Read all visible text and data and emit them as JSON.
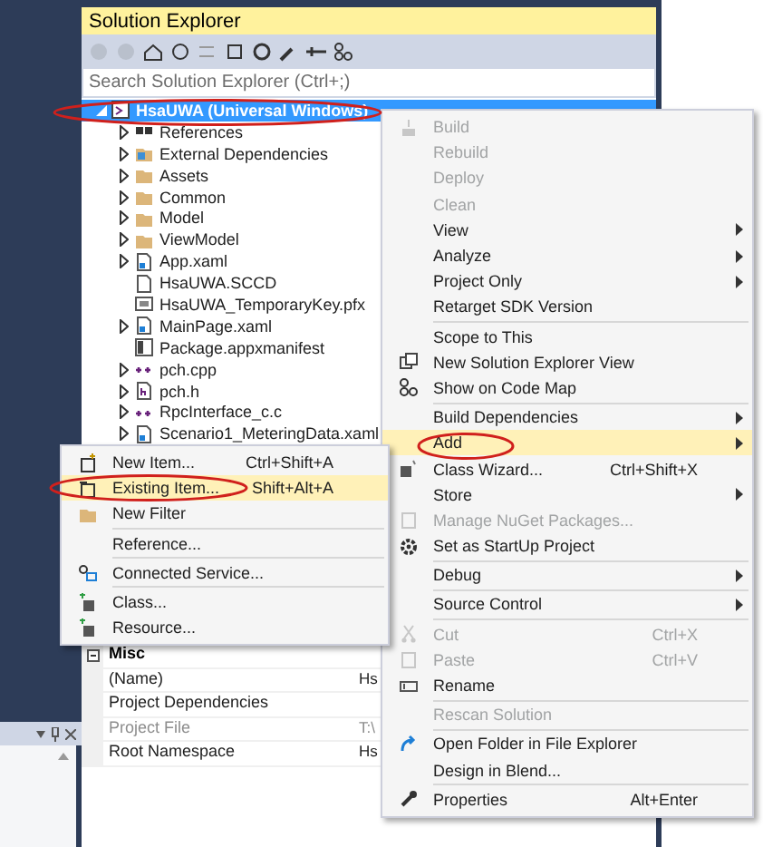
{
  "solution_explorer": {
    "title": "Solution Explorer",
    "search": {
      "placeholder": "Search Solution Explorer (Ctrl+;)"
    },
    "tree": [
      {
        "label": "HsaUWA (Universal Windows)",
        "selected": true,
        "expanded": true,
        "children": [
          {
            "label": "References",
            "selected": false,
            "expanded": false
          },
          {
            "label": "External Dependencies",
            "selected": false,
            "expanded": false
          },
          {
            "label": "Assets",
            "selected": false,
            "expanded": false
          },
          {
            "label": "Common",
            "selected": false,
            "expanded": false
          },
          {
            "label": "Model",
            "selected": false,
            "expanded": false
          },
          {
            "label": "ViewModel",
            "selected": false,
            "expanded": false
          },
          {
            "label": "App.xaml",
            "selected": false,
            "expanded": false
          },
          {
            "label": "HsaUWA.SCCD",
            "selected": false
          },
          {
            "label": "HsaUWA_TemporaryKey.pfx",
            "selected": false
          },
          {
            "label": "MainPage.xaml",
            "selected": false,
            "expanded": false
          },
          {
            "label": "Package.appxmanifest",
            "selected": false
          },
          {
            "label": "pch.cpp",
            "selected": false,
            "expanded": false
          },
          {
            "label": "pch.h",
            "selected": false,
            "expanded": false
          },
          {
            "label": "RpcInterface_c.c",
            "selected": false,
            "expanded": false
          },
          {
            "label": "Scenario1_MeteringData.xaml",
            "selected": false,
            "expanded": false
          }
        ]
      }
    ]
  },
  "properties": {
    "section": "Misc",
    "rows": [
      {
        "name": "(Name)",
        "value": "Hs",
        "disabled": false
      },
      {
        "name": "Project Dependencies",
        "disabled": false
      },
      {
        "name": "Project File",
        "value": "T:\\",
        "disabled": true
      },
      {
        "name": "Root Namespace",
        "value": "Hs",
        "disabled": false
      }
    ]
  },
  "add_submenu": {
    "items": [
      {
        "kind": "item",
        "label": "New Item...",
        "shortcut": "Ctrl+Shift+A",
        "selected": false,
        "disabled": false
      },
      {
        "kind": "item",
        "label": "Existing Item...",
        "shortcut": "Shift+Alt+A",
        "selected": true,
        "disabled": false
      },
      {
        "kind": "item",
        "label": "New Filter",
        "selected": false,
        "disabled": false
      },
      {
        "kind": "separator"
      },
      {
        "kind": "item",
        "label": "Reference...",
        "selected": false,
        "disabled": false
      },
      {
        "kind": "separator"
      },
      {
        "kind": "item",
        "label": "Connected Service...",
        "selected": false,
        "disabled": false
      },
      {
        "kind": "separator"
      },
      {
        "kind": "item",
        "label": "Class...",
        "selected": false,
        "disabled": false
      },
      {
        "kind": "item",
        "label": "Resource...",
        "selected": false,
        "disabled": false
      }
    ]
  },
  "context_menu": {
    "items": [
      {
        "kind": "item",
        "label": "Build",
        "selected": false,
        "disabled": true
      },
      {
        "kind": "item",
        "label": "Rebuild",
        "selected": false,
        "disabled": true
      },
      {
        "kind": "item",
        "label": "Deploy",
        "selected": false,
        "disabled": true
      },
      {
        "kind": "item",
        "label": "Clean",
        "selected": false,
        "disabled": true
      },
      {
        "kind": "item",
        "label": "View",
        "selected": false,
        "disabled": false,
        "submenu": true
      },
      {
        "kind": "item",
        "label": "Analyze",
        "selected": false,
        "disabled": false,
        "submenu": true
      },
      {
        "kind": "item",
        "label": "Project Only",
        "selected": false,
        "disabled": false,
        "submenu": true
      },
      {
        "kind": "item",
        "label": "Retarget SDK Version",
        "selected": false,
        "disabled": false
      },
      {
        "kind": "separator"
      },
      {
        "kind": "item",
        "label": "Scope to This",
        "selected": false,
        "disabled": false
      },
      {
        "kind": "item",
        "label": "New Solution Explorer View",
        "selected": false,
        "disabled": false
      },
      {
        "kind": "item",
        "label": "Show on Code Map",
        "selected": false,
        "disabled": false
      },
      {
        "kind": "separator"
      },
      {
        "kind": "item",
        "label": "Build Dependencies",
        "selected": false,
        "disabled": false,
        "submenu": true
      },
      {
        "kind": "item",
        "label": "Add",
        "selected": true,
        "disabled": false,
        "submenu": true
      },
      {
        "kind": "item",
        "label": "Class Wizard...",
        "shortcut": "Ctrl+Shift+X",
        "selected": false,
        "disabled": false
      },
      {
        "kind": "item",
        "label": "Store",
        "selected": false,
        "disabled": false,
        "submenu": true
      },
      {
        "kind": "item",
        "label": "Manage NuGet Packages...",
        "selected": false,
        "disabled": true
      },
      {
        "kind": "item",
        "label": "Set as StartUp Project",
        "selected": false,
        "disabled": false
      },
      {
        "kind": "separator"
      },
      {
        "kind": "item",
        "label": "Debug",
        "selected": false,
        "disabled": false,
        "submenu": true
      },
      {
        "kind": "separator"
      },
      {
        "kind": "item",
        "label": "Source Control",
        "selected": false,
        "disabled": false,
        "submenu": true
      },
      {
        "kind": "separator"
      },
      {
        "kind": "item",
        "label": "Cut",
        "shortcut": "Ctrl+X",
        "selected": false,
        "disabled": true
      },
      {
        "kind": "item",
        "label": "Paste",
        "shortcut": "Ctrl+V",
        "selected": false,
        "disabled": true
      },
      {
        "kind": "item",
        "label": "Rename",
        "selected": false,
        "disabled": false
      },
      {
        "kind": "separator"
      },
      {
        "kind": "item",
        "label": "Rescan Solution",
        "selected": false,
        "disabled": true
      },
      {
        "kind": "separator"
      },
      {
        "kind": "item",
        "label": "Open Folder in File Explorer",
        "selected": false,
        "disabled": false
      },
      {
        "kind": "item",
        "label": "Design in Blend...",
        "selected": false,
        "disabled": false
      },
      {
        "kind": "separator"
      },
      {
        "kind": "item",
        "label": "Properties",
        "shortcut": "Alt+Enter",
        "selected": false,
        "disabled": false
      }
    ]
  }
}
